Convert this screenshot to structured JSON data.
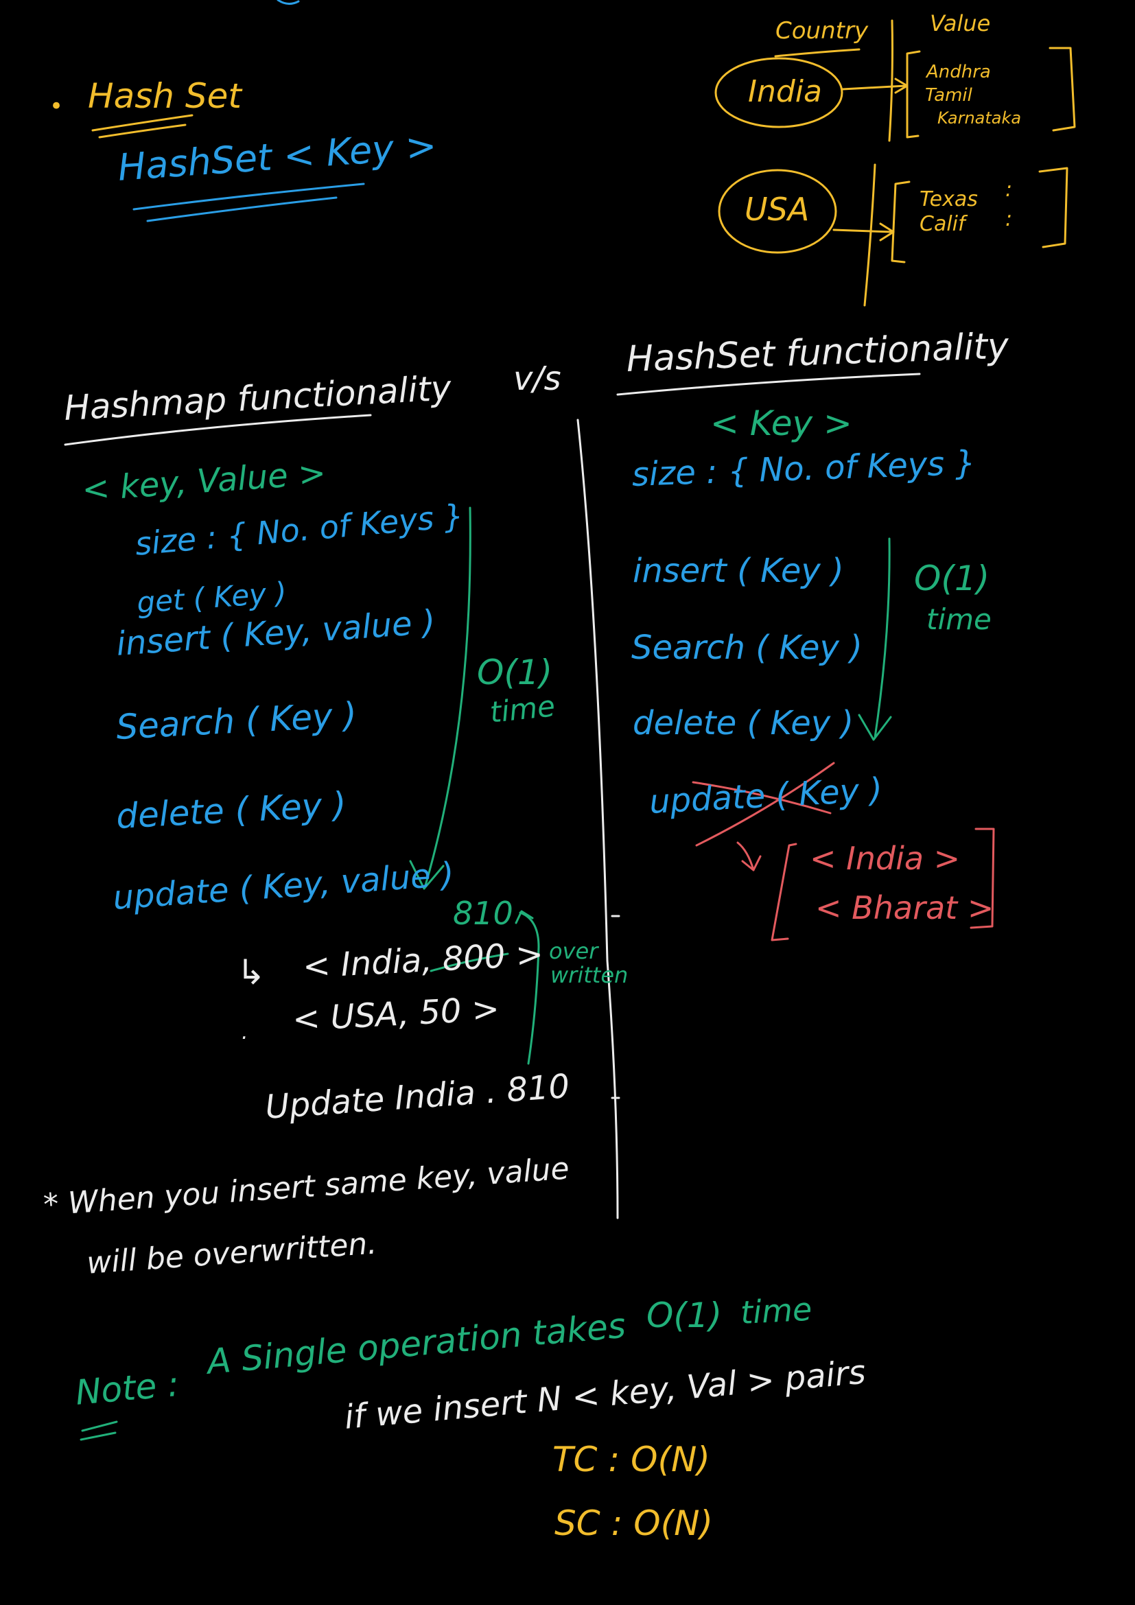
{
  "colors": {
    "background": "#000000",
    "yellow": "#f2bd2c",
    "blue": "#2a9ee6",
    "green": "#21b07a",
    "white": "#ececec",
    "red": "#e35a5e"
  },
  "hashset_heading": {
    "bullet": "•",
    "title": "Hash Set",
    "syntax": "HashSet < Key >"
  },
  "map_diagram": {
    "header_key": "Country",
    "header_value": "Value",
    "india": {
      "key": "India",
      "values": [
        "Andhra",
        "Tamil",
        "Karnataka"
      ]
    },
    "usa": {
      "key": "USA",
      "values": [
        "Texas",
        "Calif"
      ]
    }
  },
  "vs_label": "v/s",
  "hashmap": {
    "title": "Hashmap functionality",
    "signature": "< key, Value >",
    "ops": [
      "size : { No. of Keys }",
      "get ( Key )",
      "insert ( Key, value )",
      "Search ( Key )",
      "delete ( Key )",
      "update ( Key, value )"
    ],
    "complexity": [
      "O(1)",
      "time"
    ],
    "example": {
      "arrow": "↳",
      "row1": "< India, 800 >",
      "row1_replacement": "810",
      "row2": "< USA, 50 >",
      "overwritten": [
        "over",
        "written"
      ],
      "update_line": "Update India . 810"
    }
  },
  "hashset": {
    "title": "HashSet functionality",
    "signature": "< Key >",
    "ops": [
      "size : { No. of Keys }",
      "insert ( Key )",
      "Search ( Key )",
      "delete ( Key )",
      "update ( Key )"
    ],
    "complexity": [
      "O(1)",
      "time"
    ],
    "example": {
      "arrow": "↳",
      "items": [
        "< India >",
        "< Bharat >"
      ]
    }
  },
  "overwrite_note": [
    "* When you insert same key, value",
    "will be overwritten."
  ],
  "note": {
    "label": "Note :",
    "text": "A Single operation takes",
    "complexity": "O(1)",
    "time": "time",
    "line2": "if we insert N < key, Val > pairs",
    "tc": "TC : O(N)",
    "sc": "SC : O(N)"
  }
}
